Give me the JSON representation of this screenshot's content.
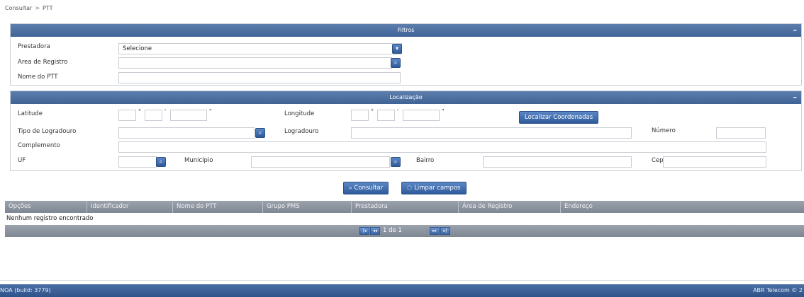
{
  "breadcrumb": {
    "root": "Consultar",
    "separator": ">",
    "current": "PTT"
  },
  "filtros": {
    "title": "Filtros",
    "collapse": "–",
    "prestadora": {
      "label": "Prestadora",
      "value": "Selecione"
    },
    "area": {
      "label": "Area de Registro",
      "value": ""
    },
    "nome": {
      "label": "Nome do PTT",
      "value": ""
    }
  },
  "localizacao": {
    "title": "Localização",
    "collapse": "–",
    "latitude": {
      "label": "Latitude",
      "deg": "°",
      "min": "'",
      "sec": "\""
    },
    "longitude": {
      "label": "Longitude",
      "deg": "°",
      "min": "'",
      "sec": "\""
    },
    "localizar_button": "Localizar Coordenadas",
    "tipo_logradouro": {
      "label": "Tipo de Logradouro"
    },
    "logradouro": {
      "label": "Logradouro"
    },
    "numero": {
      "label": "Número"
    },
    "complemento": {
      "label": "Complemento"
    },
    "uf": {
      "label": "UF"
    },
    "municipio": {
      "label": "Município"
    },
    "bairro": {
      "label": "Bairro"
    },
    "cep": {
      "label": "Cep"
    }
  },
  "actions": {
    "consultar": "Consultar",
    "limpar": "Limpar campos"
  },
  "grid": {
    "columns": [
      "Opções",
      "Identificador",
      "Nome do PTT",
      "Grupo PMS",
      "Prestadora",
      "Área de Registro",
      "Endereço"
    ],
    "empty_message": "Nenhum registro encontrado",
    "pager": {
      "text": "1 de 1",
      "first": "|◂",
      "prev": "◂◂",
      "next": "▸▸",
      "last": "▸|"
    }
  },
  "footer": {
    "left": "NOA (build: 3779)",
    "right": "ABR Telecom © 2"
  },
  "icons": {
    "search": "search-icon",
    "dropdown": "chevron-down-icon"
  },
  "colors": {
    "header": "#4a6fa5",
    "grid_header": "#8a929d",
    "button": "#3a66a8"
  }
}
